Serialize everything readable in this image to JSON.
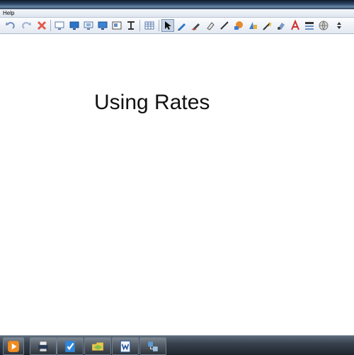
{
  "menu": {
    "help": "Help"
  },
  "toolbar": {
    "buttons": [
      "undo-icon",
      "redo-icon",
      "delete-icon",
      "screen-shade-icon",
      "monitor-icon",
      "capture-icon",
      "display-icon",
      "screen-capture-icon",
      "document-camera-icon",
      "table-icon",
      "select-arrow-icon",
      "pen-icon",
      "creative-pen-icon",
      "highlighter-icon",
      "line-icon",
      "fill-icon",
      "shapes-icon",
      "magic-pen-icon",
      "eraser-icon",
      "text-icon",
      "properties-icon",
      "globe-icon",
      "more-icon"
    ]
  },
  "canvas": {
    "title": "Using Rates"
  },
  "taskbar": {
    "items": [
      "media-player-icon",
      "printer-icon",
      "notebook-icon",
      "folder-icon",
      "word-icon",
      "network-icon"
    ]
  }
}
